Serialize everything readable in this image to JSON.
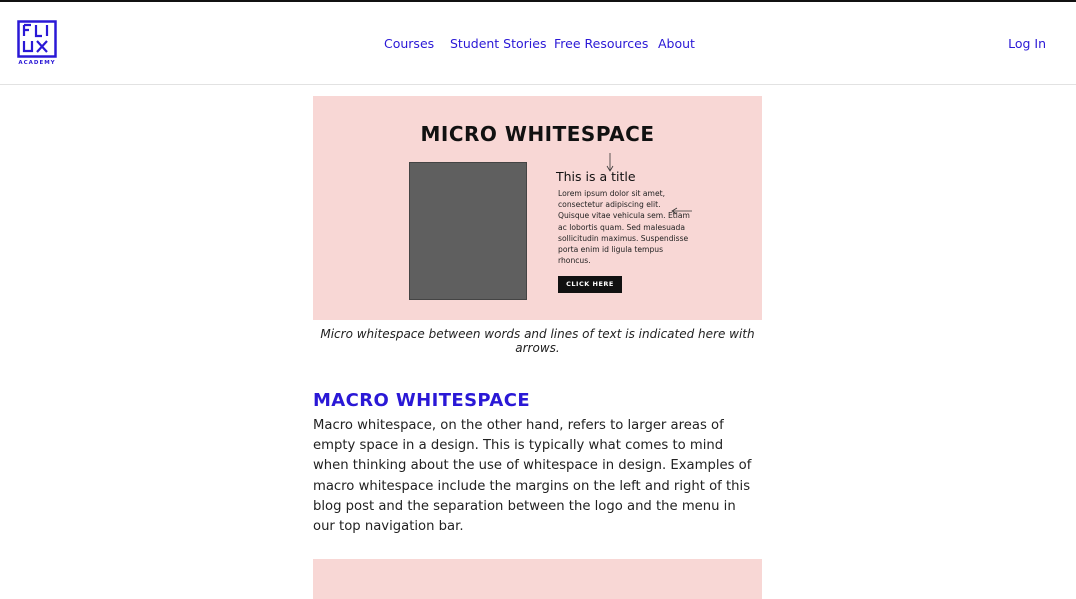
{
  "logo": {
    "letters": "FLUX",
    "subtitle": "ACADEMY"
  },
  "nav": {
    "items": [
      {
        "label": "Courses"
      },
      {
        "label": "Student Stories"
      },
      {
        "label": "Free Resources"
      },
      {
        "label": "About"
      }
    ],
    "login_label": "Log In"
  },
  "hero": {
    "title": "MICRO WHITESPACE",
    "sample_title": "This is a title",
    "sample_body": "Lorem ipsum dolor sit amet, consectetur adipiscing elit. Quisque vitae vehicula sem. Etiam ac lobortis quam. Sed malesuada sollicitudin maximus. Suspendisse porta enim id ligula tempus rhoncus.",
    "sample_button": "CLICK HERE"
  },
  "caption": "Micro whitespace between words and lines of text is indicated here with arrows.",
  "section": {
    "heading": "MACRO WHITESPACE",
    "body": "Macro whitespace, on the other hand, refers to larger areas of empty space in a design. This is typically what comes to mind when thinking about the use of whitespace in design. Examples of macro whitespace include the margins on the left and right of this blog post and the separation between the logo and the menu in our top navigation bar."
  },
  "colors": {
    "brand": "#2a18d6",
    "hero_bg": "#f8d7d5",
    "placeholder_gray": "#5f5f5f"
  }
}
